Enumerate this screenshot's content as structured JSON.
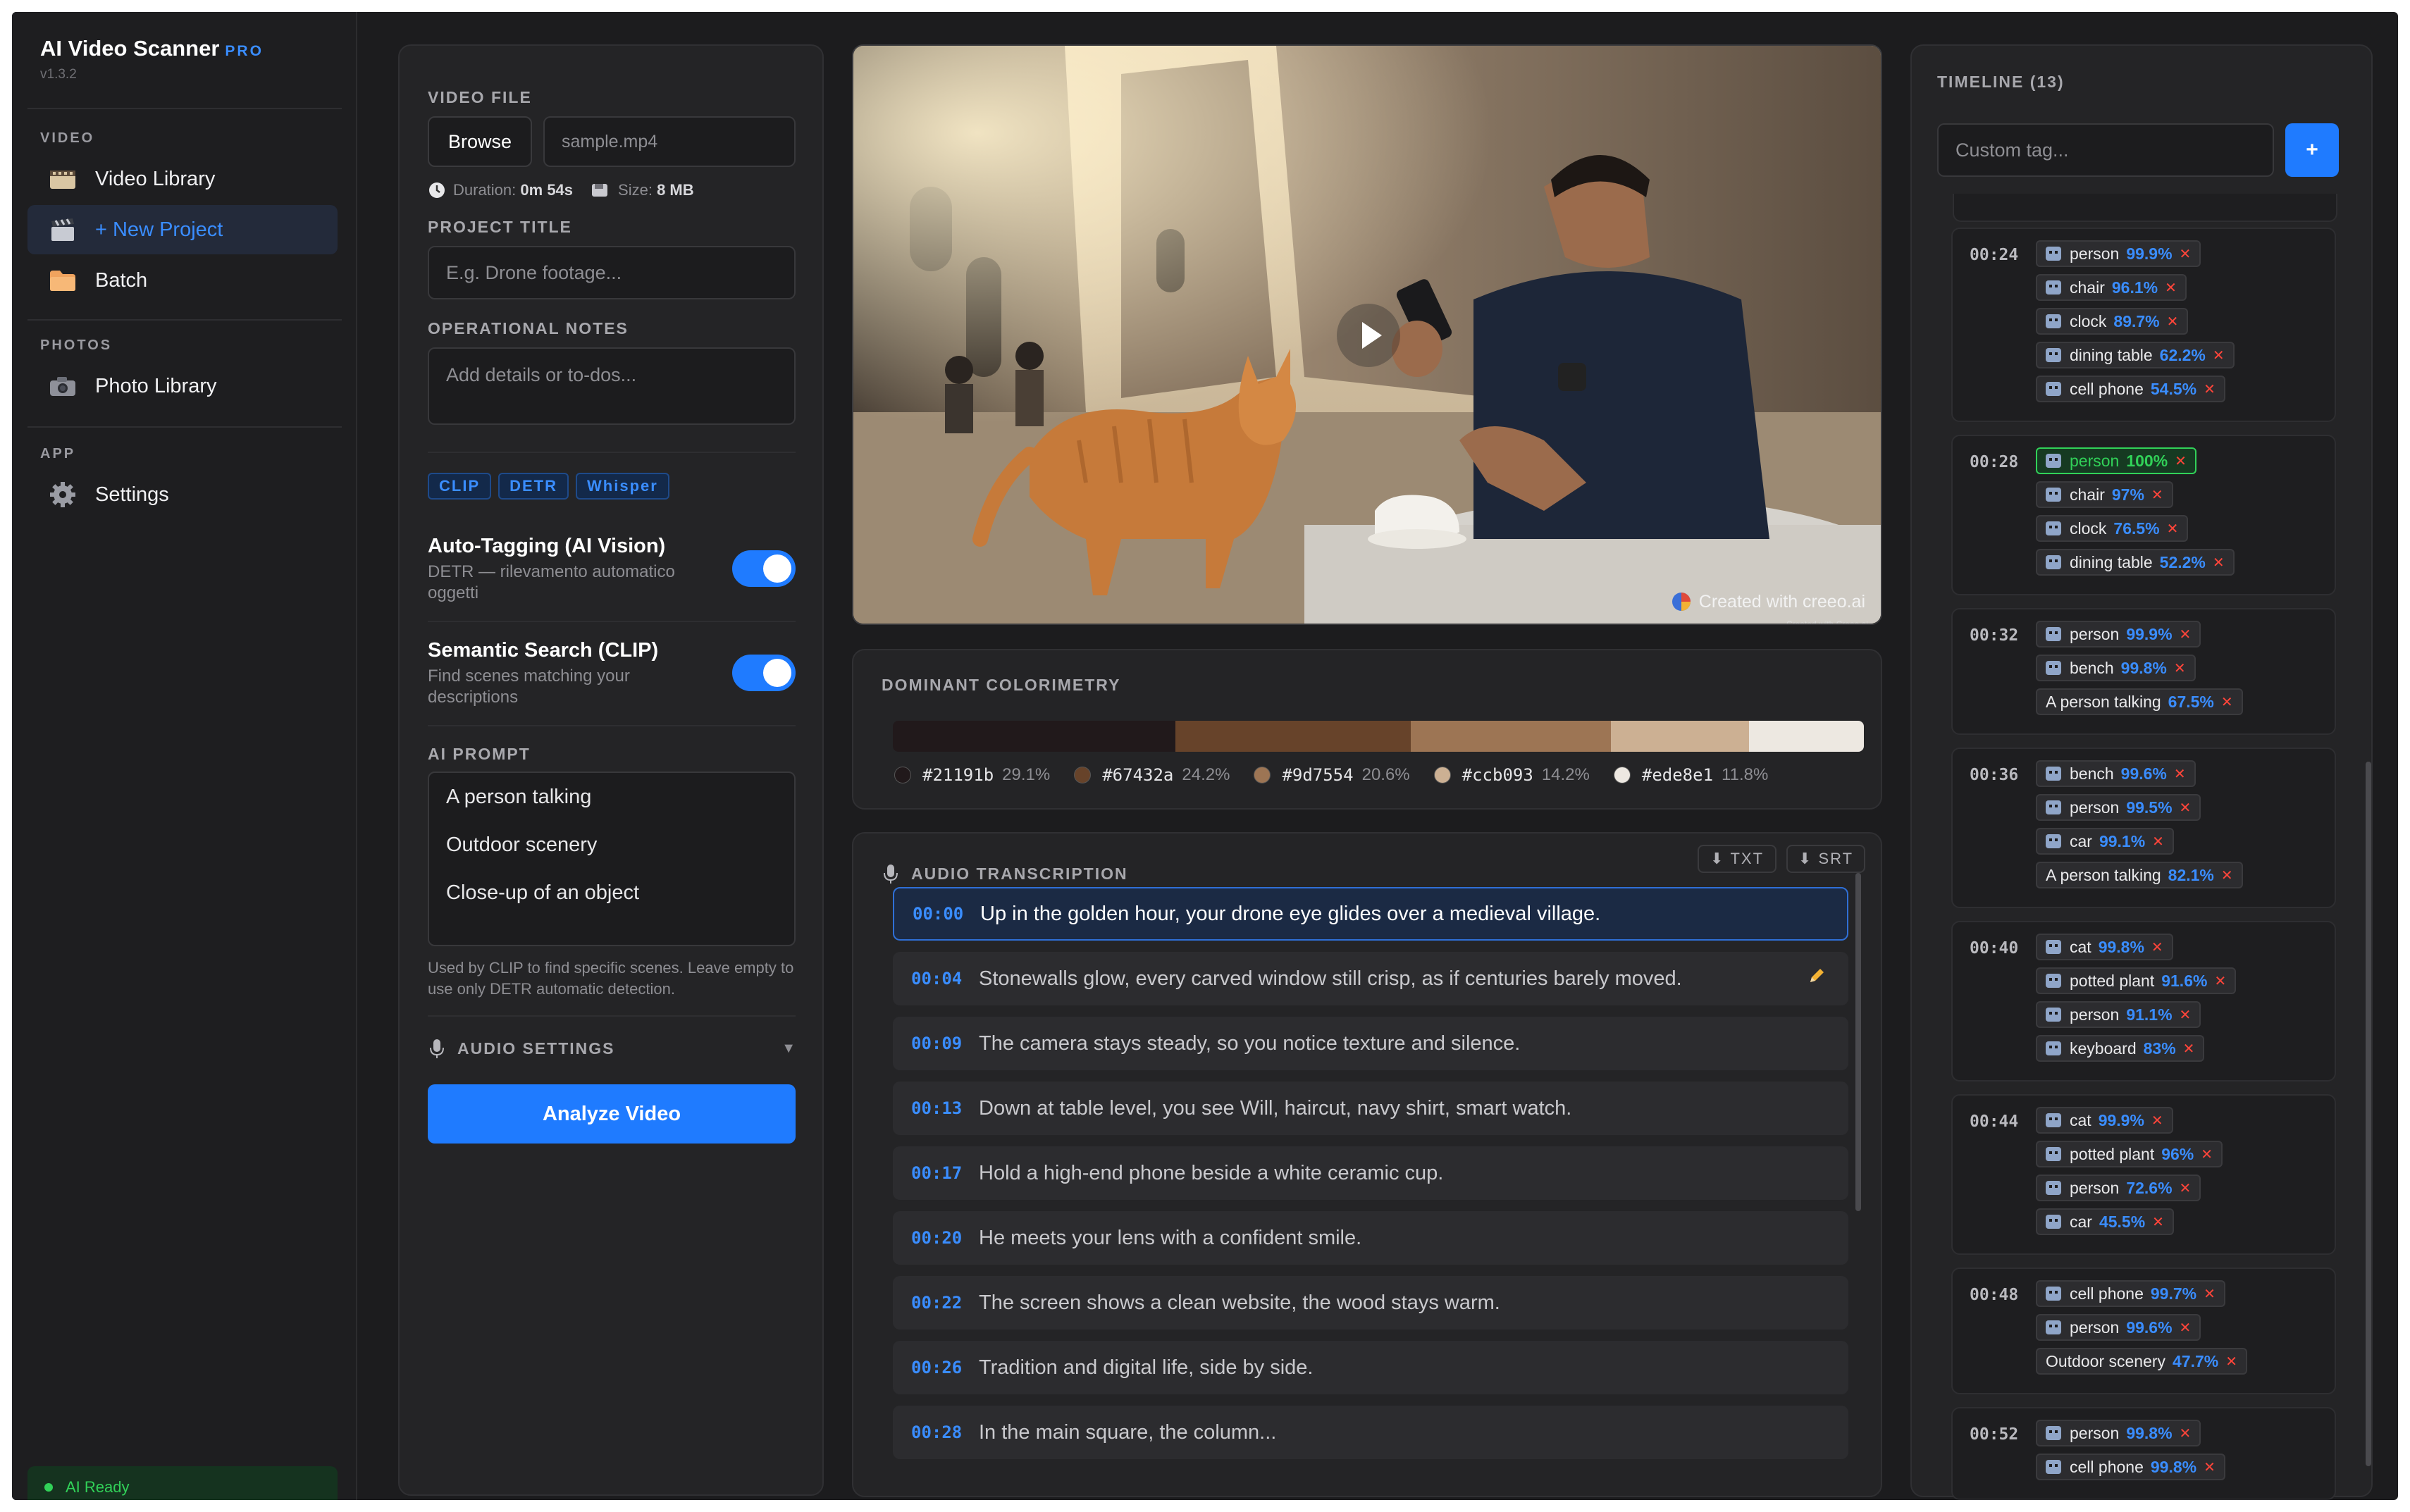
{
  "app": {
    "name": "AI Video Scanner",
    "badge": "PRO",
    "version": "v1.3.2"
  },
  "sidebar": {
    "sections": [
      {
        "title": "VIDEO",
        "items": [
          {
            "label": "Video Library",
            "icon": "film-icon"
          },
          {
            "label": "+ New Project",
            "icon": "clapper-icon",
            "active": true
          },
          {
            "label": "Batch",
            "icon": "folder-icon"
          }
        ]
      },
      {
        "title": "PHOTOS",
        "items": [
          {
            "label": "Photo Library",
            "icon": "camera-icon"
          }
        ]
      },
      {
        "title": "APP",
        "items": [
          {
            "label": "Settings",
            "icon": "gear-icon"
          }
        ]
      }
    ],
    "status": "AI Ready"
  },
  "form": {
    "video_file_label": "VIDEO FILE",
    "browse": "Browse",
    "file_name": "sample.mp4",
    "duration_label": "Duration:",
    "duration": "0m 54s",
    "size_label": "Size:",
    "size": "8 MB",
    "project_title_label": "PROJECT TITLE",
    "project_title_placeholder": "E.g. Drone footage...",
    "notes_label": "OPERATIONAL NOTES",
    "notes_placeholder": "Add details or to-dos...",
    "models": [
      "CLIP",
      "DETR",
      "Whisper"
    ],
    "auto_tagging": {
      "title": "Auto-Tagging (AI Vision)",
      "desc": "DETR — rilevamento automatico oggetti",
      "on": true
    },
    "semantic_search": {
      "title": "Semantic Search (CLIP)",
      "desc": "Find scenes matching your descriptions",
      "on": true
    },
    "prompt_label": "AI PROMPT",
    "prompt_lines": [
      "A person talking",
      "Outdoor scenery",
      "Close-up of an object"
    ],
    "prompt_help": "Used by CLIP to find specific scenes. Leave empty to use only DETR automatic detection.",
    "audio_settings": "AUDIO SETTINGS",
    "analyze": "Analyze Video"
  },
  "video": {
    "watermark": "Created with creeo.ai",
    "watermark_small": "Created with Creeo.ai"
  },
  "colorimetry": {
    "label": "DOMINANT COLORIMETRY",
    "colors": [
      {
        "hex": "#21191b",
        "pct": "29.1%",
        "value": 29.1
      },
      {
        "hex": "#67432a",
        "pct": "24.2%",
        "value": 24.2
      },
      {
        "hex": "#9d7554",
        "pct": "20.6%",
        "value": 20.6
      },
      {
        "hex": "#ccb093",
        "pct": "14.2%",
        "value": 14.2
      },
      {
        "hex": "#ede8e1",
        "pct": "11.8%",
        "value": 11.8
      }
    ]
  },
  "transcription": {
    "label": "AUDIO TRANSCRIPTION",
    "txt": "TXT",
    "srt": "SRT",
    "rows": [
      {
        "time": "00:00",
        "text": "Up in the golden hour, your drone eye glides over a medieval village."
      },
      {
        "time": "00:04",
        "text": "Stonewalls glow, every carved window still crisp, as if centuries barely moved."
      },
      {
        "time": "00:09",
        "text": "The camera stays steady, so you notice texture and silence."
      },
      {
        "time": "00:13",
        "text": "Down at table level, you see Will, haircut, navy shirt, smart watch."
      },
      {
        "time": "00:17",
        "text": "Hold a high-end phone beside a white ceramic cup."
      },
      {
        "time": "00:20",
        "text": "He meets your lens with a confident smile."
      },
      {
        "time": "00:22",
        "text": "The screen shows a clean website, the wood stays warm."
      },
      {
        "time": "00:26",
        "text": "Tradition and digital life, side by side."
      },
      {
        "time": "00:28",
        "text": "In the main square, the column..."
      }
    ]
  },
  "timeline": {
    "label": "TIMELINE (13)",
    "custom_tag_placeholder": "Custom tag...",
    "add": "+",
    "entries": [
      {
        "time": "00:24",
        "tags": [
          {
            "name": "person",
            "pct": "99.9%"
          },
          {
            "name": "chair",
            "pct": "96.1%"
          },
          {
            "name": "clock",
            "pct": "89.7%"
          },
          {
            "name": "dining table",
            "pct": "62.2%"
          },
          {
            "name": "cell phone",
            "pct": "54.5%"
          }
        ]
      },
      {
        "time": "00:28",
        "tags": [
          {
            "name": "person",
            "pct": "100%",
            "hl": true
          },
          {
            "name": "chair",
            "pct": "97%"
          },
          {
            "name": "clock",
            "pct": "76.5%"
          },
          {
            "name": "dining table",
            "pct": "52.2%"
          }
        ]
      },
      {
        "time": "00:32",
        "tags": [
          {
            "name": "person",
            "pct": "99.9%"
          },
          {
            "name": "bench",
            "pct": "99.8%"
          },
          {
            "name": "A person talking",
            "pct": "67.5%",
            "text": true
          }
        ]
      },
      {
        "time": "00:36",
        "tags": [
          {
            "name": "bench",
            "pct": "99.6%"
          },
          {
            "name": "person",
            "pct": "99.5%"
          },
          {
            "name": "car",
            "pct": "99.1%"
          },
          {
            "name": "A person talking",
            "pct": "82.1%",
            "text": true
          }
        ]
      },
      {
        "time": "00:40",
        "tags": [
          {
            "name": "cat",
            "pct": "99.8%"
          },
          {
            "name": "potted plant",
            "pct": "91.6%"
          },
          {
            "name": "person",
            "pct": "91.1%"
          },
          {
            "name": "keyboard",
            "pct": "83%"
          }
        ]
      },
      {
        "time": "00:44",
        "tags": [
          {
            "name": "cat",
            "pct": "99.9%"
          },
          {
            "name": "potted plant",
            "pct": "96%"
          },
          {
            "name": "person",
            "pct": "72.6%"
          },
          {
            "name": "car",
            "pct": "45.5%"
          }
        ]
      },
      {
        "time": "00:48",
        "tags": [
          {
            "name": "cell phone",
            "pct": "99.7%"
          },
          {
            "name": "person",
            "pct": "99.6%"
          },
          {
            "name": "Outdoor scenery",
            "pct": "47.7%",
            "text": true
          }
        ]
      },
      {
        "time": "00:52",
        "tags": [
          {
            "name": "person",
            "pct": "99.8%"
          },
          {
            "name": "cell phone",
            "pct": "99.8%"
          }
        ]
      }
    ]
  }
}
